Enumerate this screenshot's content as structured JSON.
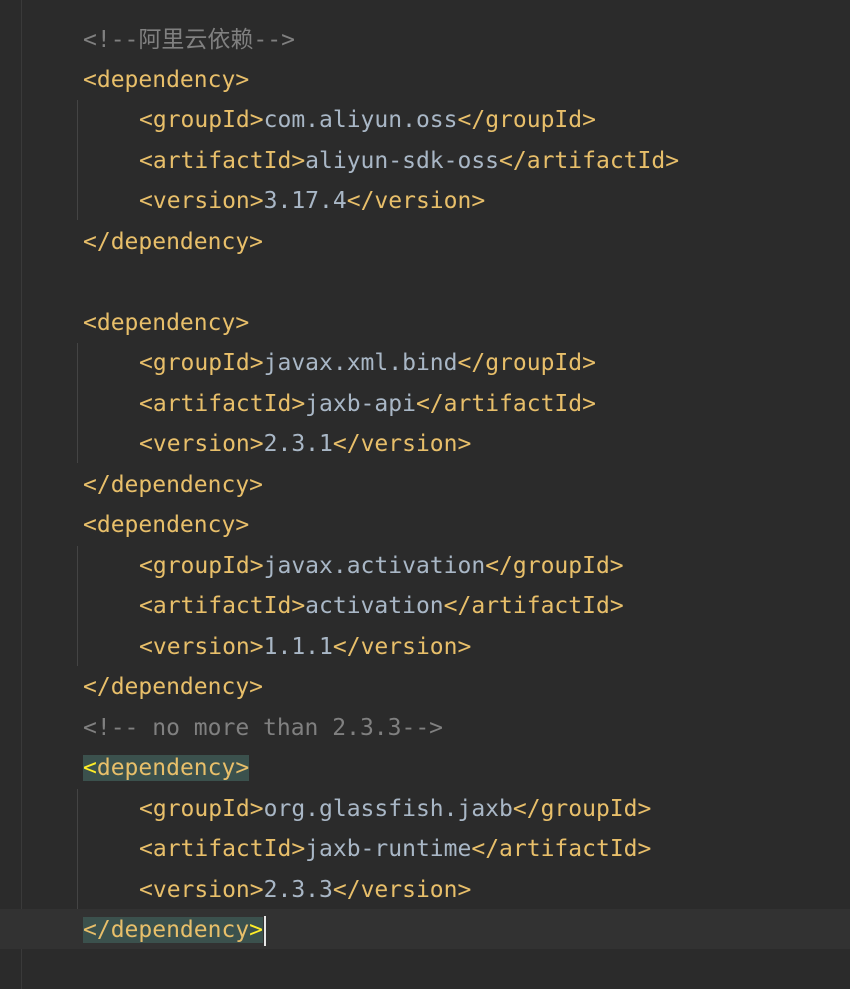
{
  "lines": [
    {
      "kind": "comment",
      "text": "<!--阿里云依赖-->"
    },
    {
      "kind": "open",
      "tag": "<dependency>"
    },
    {
      "kind": "child",
      "open": "<groupId>",
      "value": "com.aliyun.oss",
      "close": "</groupId>"
    },
    {
      "kind": "child",
      "open": "<artifactId>",
      "value": "aliyun-sdk-oss",
      "close": "</artifactId>"
    },
    {
      "kind": "child",
      "open": "<version>",
      "value": "3.17.4",
      "close": "</version>"
    },
    {
      "kind": "close",
      "tag": "</dependency>"
    },
    {
      "kind": "open",
      "tag": "<dependency>"
    },
    {
      "kind": "child",
      "open": "<groupId>",
      "value": "javax.xml.bind",
      "close": "</groupId>"
    },
    {
      "kind": "child",
      "open": "<artifactId>",
      "value": "jaxb-api",
      "close": "</artifactId>"
    },
    {
      "kind": "child",
      "open": "<version>",
      "value": "2.3.1",
      "close": "</version>"
    },
    {
      "kind": "close",
      "tag": "</dependency>"
    },
    {
      "kind": "open",
      "tag": "<dependency>"
    },
    {
      "kind": "child",
      "open": "<groupId>",
      "value": "javax.activation",
      "close": "</groupId>"
    },
    {
      "kind": "child",
      "open": "<artifactId>",
      "value": "activation",
      "close": "</artifactId>"
    },
    {
      "kind": "child",
      "open": "<version>",
      "value": "1.1.1",
      "close": "</version>"
    },
    {
      "kind": "close",
      "tag": "</dependency>"
    },
    {
      "kind": "comment",
      "text": "<!-- no more than 2.3.3-->"
    },
    {
      "kind": "open",
      "tag_first": "<",
      "tag_rest": "dependency>"
    },
    {
      "kind": "child",
      "open": "<groupId>",
      "value": "org.glassfish.jaxb",
      "close": "</groupId>"
    },
    {
      "kind": "child",
      "open": "<artifactId>",
      "value": "jaxb-runtime",
      "close": "</artifactId>"
    },
    {
      "kind": "child",
      "open": "<version>",
      "value": "2.3.3",
      "close": "</version>"
    },
    {
      "kind": "close",
      "tag_first": "</dependency",
      "tag_rest": ">"
    }
  ],
  "colors": {
    "background": "#2b2b2b",
    "current_line": "#323232",
    "tag": "#e8bf6a",
    "text": "#a9b7c6",
    "comment": "#808080",
    "brace_match_bg": "#3b514d",
    "brace_match_fg": "#ffef28"
  }
}
